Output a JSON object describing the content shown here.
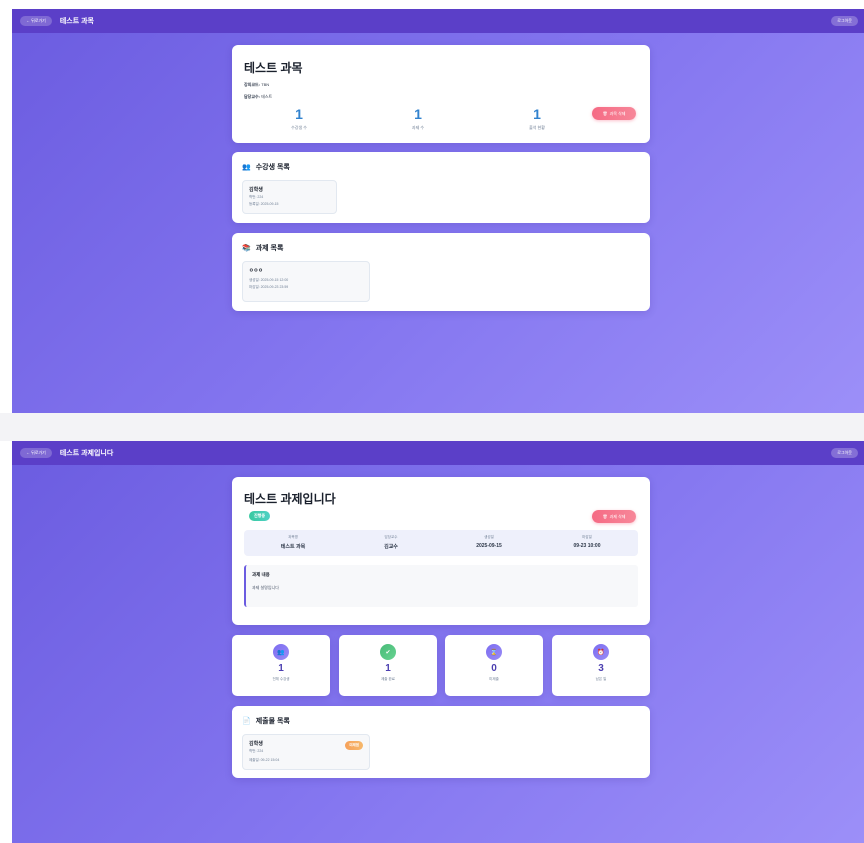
{
  "screen1": {
    "topbar": {
      "back_label": "← 뒤로가기",
      "title": "테스트 과목",
      "logout_label": "로그아웃"
    },
    "course": {
      "title": "테스트 과목",
      "code_label": "강의코드:",
      "code_value": "TBN",
      "professor_label": "담당교수:",
      "professor_value": "테스트",
      "stats": [
        {
          "value": "1",
          "label": "수강생 수"
        },
        {
          "value": "1",
          "label": "과제 수"
        },
        {
          "value": "1",
          "label": "출석 현황"
        }
      ],
      "delete_label": "과목 삭제"
    },
    "students": {
      "title": "수강생 목록",
      "items": [
        {
          "name": "김학생",
          "id_line": "학번: 224",
          "date_line": "등록일: 2025-09-15"
        }
      ]
    },
    "assignments": {
      "title": "과제 목록",
      "items": [
        {
          "name": "ㅇㅇㅇ",
          "created": "생성일: 2025-09-15 12:00",
          "due": "마감일: 2025-09-23 23:59"
        }
      ]
    }
  },
  "screen2": {
    "topbar": {
      "back_label": "← 뒤로가기",
      "title": "테스트 과제입니다",
      "logout_label": "로그아웃"
    },
    "assignment": {
      "title": "테스트 과제입니다",
      "status_badge": "진행중",
      "delete_label": "과제 삭제",
      "info": [
        {
          "label": "과목명",
          "value": "테스트 과목"
        },
        {
          "label": "담당교수",
          "value": "김교수"
        },
        {
          "label": "생성일",
          "value": "2025-09-15"
        },
        {
          "label": "마감일",
          "value": "09-23 10:00"
        }
      ],
      "content_title": "과제 내용",
      "content_text": "과제 설명입니다"
    },
    "stat_cards": [
      {
        "icon": "people-icon",
        "glyph": "👥",
        "value": "1",
        "label": "전체 수강생"
      },
      {
        "icon": "check-icon",
        "glyph": "✔",
        "value": "1",
        "label": "제출 완료"
      },
      {
        "icon": "hourglass-icon",
        "glyph": "⌛",
        "value": "0",
        "label": "미제출"
      },
      {
        "icon": "clock-icon",
        "glyph": "⏰",
        "value": "3",
        "label": "남은 일"
      }
    ],
    "submissions": {
      "title": "제출물 목록",
      "items": [
        {
          "name": "김학생",
          "id_line": "학번: 224",
          "submitted": "제출일: 09-22 15:04",
          "badge": "미채점"
        }
      ]
    }
  },
  "colors": {
    "topbar": "#5b3fc8",
    "accent": "#6b5ce0",
    "stat_blue": "#3182ce",
    "danger": "#f56a84"
  }
}
